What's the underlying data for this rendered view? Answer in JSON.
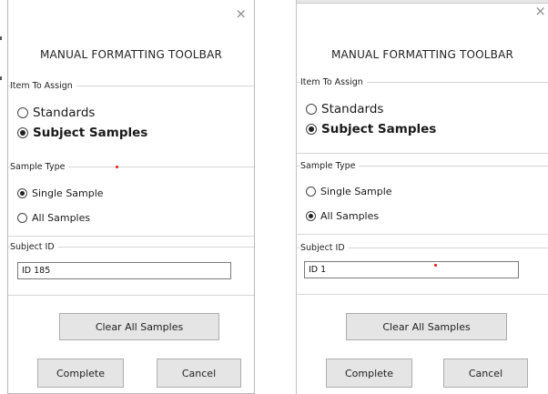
{
  "left": {
    "close_glyph": "×",
    "title": "MANUAL FORMATTING TOOLBAR",
    "item_group_label": "Item To Assign",
    "item_options": [
      {
        "label": "Standards",
        "checked": false
      },
      {
        "label": "Subject Samples",
        "checked": true
      }
    ],
    "sample_group_label": "Sample Type",
    "sample_options": [
      {
        "label": "Single Sample",
        "checked": true
      },
      {
        "label": "All Samples",
        "checked": false
      }
    ],
    "subject_group_label": "Subject ID",
    "subject_value": "ID 185",
    "clear_button": "Clear All Samples",
    "complete_button": "Complete",
    "cancel_button": "Cancel"
  },
  "right": {
    "close_glyph": "×",
    "title": "MANUAL FORMATTING TOOLBAR",
    "item_group_label": "Item To Assign",
    "item_options": [
      {
        "label": "Standards",
        "checked": false
      },
      {
        "label": "Subject Samples",
        "checked": true
      }
    ],
    "sample_group_label": "Sample Type",
    "sample_options": [
      {
        "label": "Single Sample",
        "checked": false
      },
      {
        "label": "All Samples",
        "checked": true
      }
    ],
    "subject_group_label": "Subject ID",
    "subject_value": "ID 1",
    "clear_button": "Clear All Samples",
    "complete_button": "Complete",
    "cancel_button": "Cancel"
  },
  "colors": {
    "annotation_marker": "#e01818",
    "button_bg": "#e5e5e5"
  }
}
